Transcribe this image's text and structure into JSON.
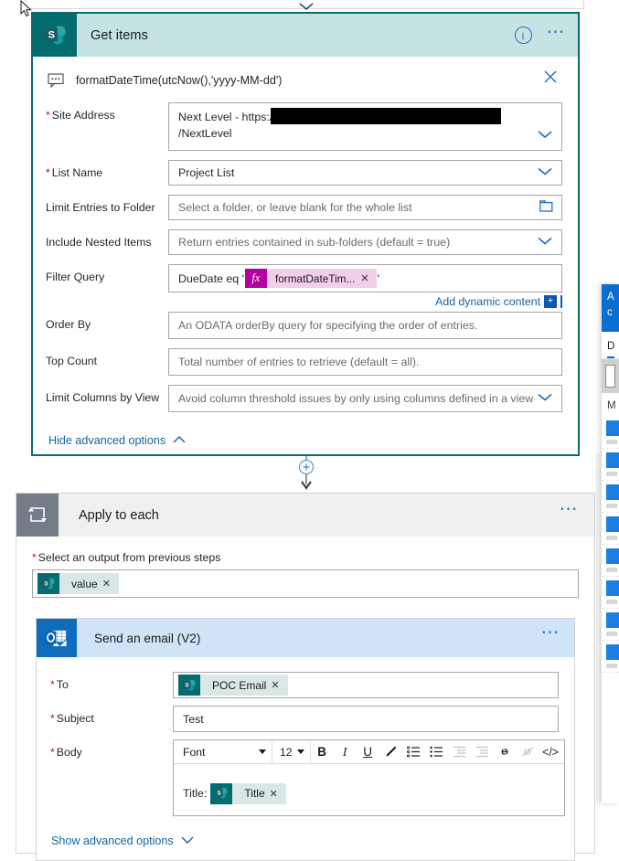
{
  "get_items": {
    "title": "Get items",
    "icon": "sharepoint-icon",
    "comment": "formatDateTime(utcNow(),'yyyy-MM-dd')",
    "fields": {
      "site_address": {
        "label": "Site Address",
        "required": true,
        "value_prefix": "Next Level - https:/",
        "value_suffix": "/NextLevel",
        "redacted": true
      },
      "list_name": {
        "label": "List Name",
        "required": true,
        "value": "Project List"
      },
      "limit_entries_to_folder": {
        "label": "Limit Entries to Folder",
        "required": false,
        "placeholder": "Select a folder, or leave blank for the whole list"
      },
      "include_nested_items": {
        "label": "Include Nested Items",
        "required": false,
        "value": "Return entries contained in sub-folders (default = true)"
      },
      "filter_query": {
        "label": "Filter Query",
        "required": false,
        "prefix_text": "DueDate eq '",
        "token_label": "formatDateTim...",
        "token_type": "fx",
        "suffix_text": "'"
      },
      "order_by": {
        "label": "Order By",
        "required": false,
        "placeholder": "An ODATA orderBy query for specifying the order of entries."
      },
      "top_count": {
        "label": "Top Count",
        "required": false,
        "placeholder": "Total number of entries to retrieve (default = all)."
      },
      "limit_columns_by_view": {
        "label": "Limit Columns by View",
        "required": false,
        "value": "Avoid column threshold issues by only using columns defined in a view"
      }
    },
    "add_dynamic_content": "Add dynamic content",
    "hide_advanced_options": "Hide advanced options"
  },
  "apply_to_each": {
    "title": "Apply to each",
    "icon": "loop-icon",
    "select_output_label": "Select an output from previous steps",
    "select_output_required": true,
    "selected_token": "value",
    "selected_token_icon": "sharepoint-icon"
  },
  "send_email": {
    "title": "Send an email (V2)",
    "icon": "outlook-icon",
    "to": {
      "label": "To",
      "required": true,
      "token": "POC Email",
      "token_icon": "sharepoint-icon"
    },
    "subject": {
      "label": "Subject",
      "required": true,
      "value": "Test"
    },
    "body": {
      "label": "Body",
      "required": true,
      "pre_text": "Title:",
      "token": "Title",
      "token_icon": "sharepoint-icon"
    },
    "toolbar": {
      "font_label": "Font",
      "size_label": "12",
      "buttons": [
        {
          "name": "bold-icon",
          "glyph": "B"
        },
        {
          "name": "italic-icon",
          "glyph": "I"
        },
        {
          "name": "underline-icon",
          "glyph": "U"
        },
        {
          "name": "text-color-icon",
          "glyph": "pen"
        },
        {
          "name": "numbered-list-icon",
          "glyph": "ol"
        },
        {
          "name": "bulleted-list-icon",
          "glyph": "ul"
        },
        {
          "name": "decrease-indent-icon",
          "glyph": "outdent"
        },
        {
          "name": "increase-indent-icon",
          "glyph": "indent"
        },
        {
          "name": "insert-link-icon",
          "glyph": "link"
        },
        {
          "name": "remove-link-icon",
          "glyph": "unlink"
        },
        {
          "name": "code-view-icon",
          "glyph": "</>"
        }
      ]
    },
    "show_advanced_options": "Show advanced options"
  },
  "dynamic_panel": {
    "header_line1": "A",
    "header_line2": "c",
    "tab_label": "D",
    "group_label": "M"
  },
  "colors": {
    "sharepoint_teal": "#036C70",
    "sharepoint_header": "#C5E3E3",
    "card_border_active": "#0B6A6E",
    "outlook_blue": "#0F6CBD",
    "outlook_header": "#CFE4F7",
    "loop_gray": "#747C87",
    "link_blue": "#1264A3",
    "required_red": "#A4262C",
    "token_magenta": "#B4009E",
    "token_pink_bg": "#F0CFE8",
    "panel_blue": "#0A6ED1"
  }
}
